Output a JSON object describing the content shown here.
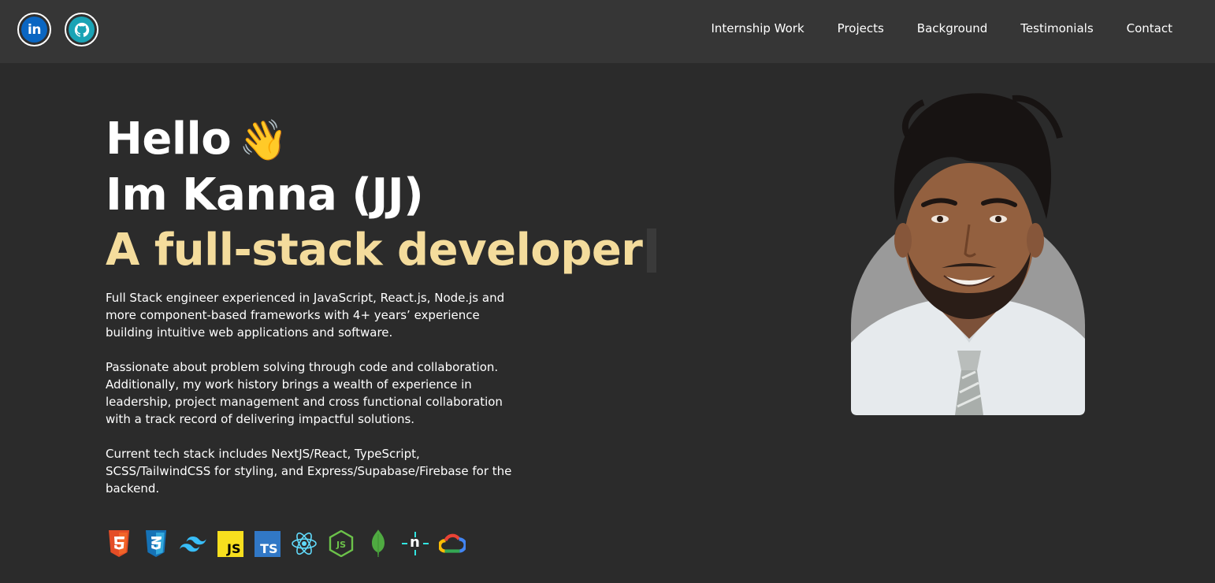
{
  "nav": {
    "links": [
      "Internship Work",
      "Projects",
      "Background",
      "Testimonials",
      "Contact"
    ],
    "social": [
      {
        "name": "linkedin-icon",
        "label": "in"
      },
      {
        "name": "github-icon"
      }
    ]
  },
  "hero": {
    "line1": "Hello",
    "wave": "👋",
    "line2": "Im Kanna (JJ)",
    "line3": "A full-stack developer"
  },
  "bio": {
    "p1": "Full Stack engineer experienced in JavaScript, React.js, Node.js and more component-based frameworks with 4+ years’ experience building intuitive web applications and software.",
    "p2": "Passionate about problem solving through code and collaboration. Additionally, my work history brings a wealth of experience in leadership, project management and cross functional collaboration with a track record of delivering impactful solutions.",
    "p3": "Current tech stack includes NextJS/React, TypeScript, SCSS/TailwindCSS for styling, and Express/Supabase/Firebase for the backend."
  },
  "tech_icons": [
    "html5-icon",
    "css3-icon",
    "tailwind-icon",
    "javascript-icon",
    "typescript-icon",
    "react-icon",
    "nodejs-icon",
    "mongodb-icon",
    "netlify-icon",
    "google-cloud-icon"
  ],
  "tech_labels": {
    "js": "JS",
    "ts": "TS",
    "n": "n"
  },
  "colors": {
    "background": "#2b2b2b",
    "navbar": "#363636",
    "accent": "#f4dc9c"
  }
}
